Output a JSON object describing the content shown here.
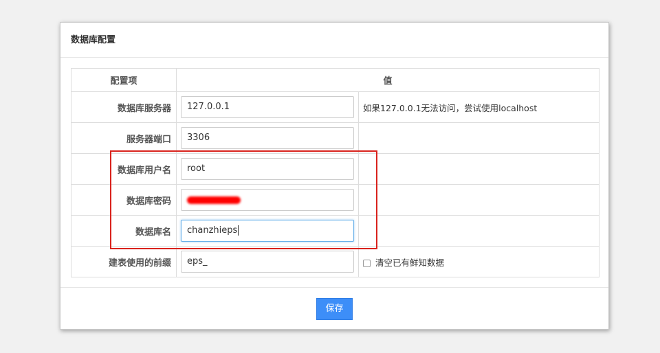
{
  "dialog": {
    "title": "数据库配置",
    "table": {
      "headers": [
        "配置项",
        "值"
      ],
      "rows": [
        {
          "label": "数据库服务器",
          "value": "127.0.0.1",
          "tip": "如果127.0.0.1无法访问，尝试使用localhost"
        },
        {
          "label": "服务器端口",
          "value": "3306"
        },
        {
          "label": "数据库用户名",
          "value": "root"
        },
        {
          "label": "数据库密码",
          "value": ""
        },
        {
          "label": "数据库名",
          "value": "chanzhieps"
        },
        {
          "label": "建表使用的前缀",
          "value": "eps_",
          "checkbox_label": "清空已有鲜知数据",
          "checked": false
        }
      ]
    },
    "save_label": "保存"
  },
  "colors": {
    "primary_button": "#3d8ef8",
    "highlight_box": "#d9221c",
    "redaction": "#ff0000"
  }
}
